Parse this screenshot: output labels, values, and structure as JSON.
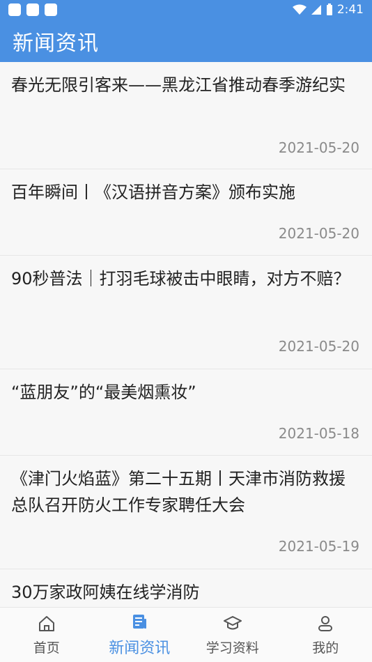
{
  "status_bar": {
    "time": "2:41"
  },
  "app_bar": {
    "title": "新闻资讯"
  },
  "news": [
    {
      "title": "春光无限引客来——黑龙江省推动春季游纪实",
      "date": "2021-05-20"
    },
    {
      "title": "百年瞬间丨《汉语拼音方案》颁布实施",
      "date": "2021-05-20"
    },
    {
      "title": "90秒普法｜打羽毛球被击中眼睛，对方不赔？",
      "date": "2021-05-20"
    },
    {
      "title": "“蓝朋友”的“最美烟熏妆”",
      "date": "2021-05-18"
    },
    {
      "title": "《津门火焰蓝》第二十五期丨天津市消防救援总队召开防火工作专家聘任大会",
      "date": "2021-05-19"
    },
    {
      "title": "30万家政阿姨在线学消防",
      "date": ""
    }
  ],
  "tabs": [
    {
      "label": "首页",
      "icon": "home-icon"
    },
    {
      "label": "新闻资讯",
      "icon": "news-icon"
    },
    {
      "label": "学习资料",
      "icon": "graduation-cap-icon"
    },
    {
      "label": "我的",
      "icon": "user-icon"
    }
  ],
  "colors": {
    "primary": "#4a90e2",
    "text": "#222222",
    "date": "#8a8a8a"
  }
}
